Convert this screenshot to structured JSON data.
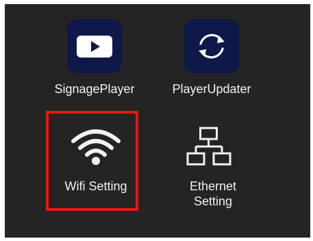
{
  "launcher": {
    "apps": [
      {
        "label": "SignagePlayer",
        "icon": "play-button-icon",
        "badge_color": "#0e1949"
      },
      {
        "label": "PlayerUpdater",
        "icon": "refresh-arrows-icon",
        "badge_color": "#0e1949"
      },
      {
        "label": "Wifi Setting",
        "icon": "wifi-icon",
        "selected": true
      },
      {
        "label_line1": "Ethernet",
        "label_line2": "Setting",
        "icon": "ethernet-network-icon"
      }
    ]
  },
  "colors": {
    "background": "#242424",
    "icon_white": "#f2f2f2",
    "selection_border": "#f01414"
  }
}
